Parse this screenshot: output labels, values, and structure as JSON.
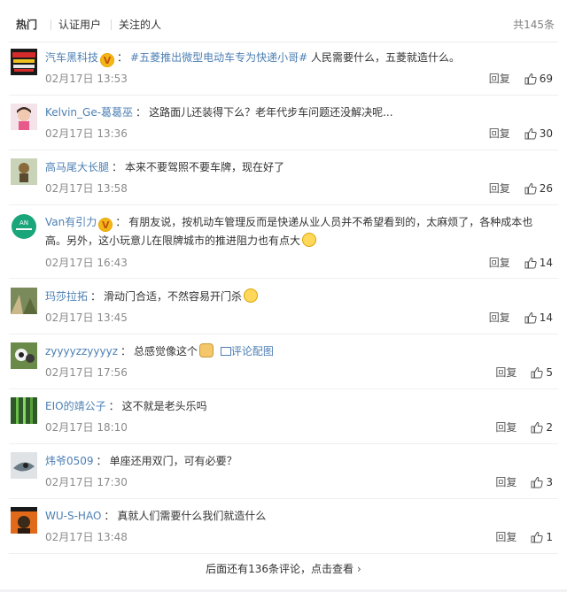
{
  "tabs": [
    {
      "label": "热门"
    },
    {
      "label": "认证用户"
    },
    {
      "label": "关注的人"
    }
  ],
  "total_label": "共145条",
  "reply_label": "回复",
  "comments": [
    {
      "user": "汽车黑科技",
      "verified": true,
      "topic": "#五菱推出微型电动车专为快递小哥#",
      "text": " 人民需要什么，五菱就造什么。",
      "time": "02月17日 13:53",
      "likes": "69"
    },
    {
      "user": "Kelvin_Ge-葛葛巫",
      "verified": false,
      "text": "这路面儿还装得下么？老年代步车问题还没解决呢...",
      "time": "02月17日 13:36",
      "likes": "30"
    },
    {
      "user": "高马尾大长腿",
      "verified": false,
      "text": "本来不要驾照不要车牌，现在好了",
      "time": "02月17日 13:58",
      "likes": "26"
    },
    {
      "user": "Van有引力",
      "verified": true,
      "text": "有朋友说，按机动车管理反而是快递从业人员并不希望看到的，太麻烦了，各种成本也高。另外，这小玩意儿在限牌城市的推进阻力也有点大",
      "time": "02月17日 16:43",
      "likes": "14"
    },
    {
      "user": "玛莎拉拓",
      "verified": false,
      "text": "滑动门合适，不然容易开门杀",
      "time": "02月17日 13:45",
      "likes": "14"
    },
    {
      "user": "zyyyyzzyyyyz",
      "verified": false,
      "text": "总感觉像这个",
      "link": "评论配图",
      "time": "02月17日 17:56",
      "likes": "5"
    },
    {
      "user": "EIO的靖公子",
      "verified": false,
      "text": "这不就是老头乐吗",
      "time": "02月17日 18:10",
      "likes": "2"
    },
    {
      "user": "炜爷0509",
      "verified": false,
      "text": "单座还用双门，可有必要？",
      "time": "02月17日 17:30",
      "likes": "3"
    },
    {
      "user": "WU-S-HAO",
      "verified": false,
      "text": "真就人们需要什么我们就造什么",
      "time": "02月17日 13:48",
      "likes": "1"
    }
  ],
  "footer": {
    "label": "后面还有136条评论，点击查看"
  },
  "colors": {
    "username": "#eb7350",
    "link": "#4c7fb3",
    "badge": "#f3b817"
  }
}
